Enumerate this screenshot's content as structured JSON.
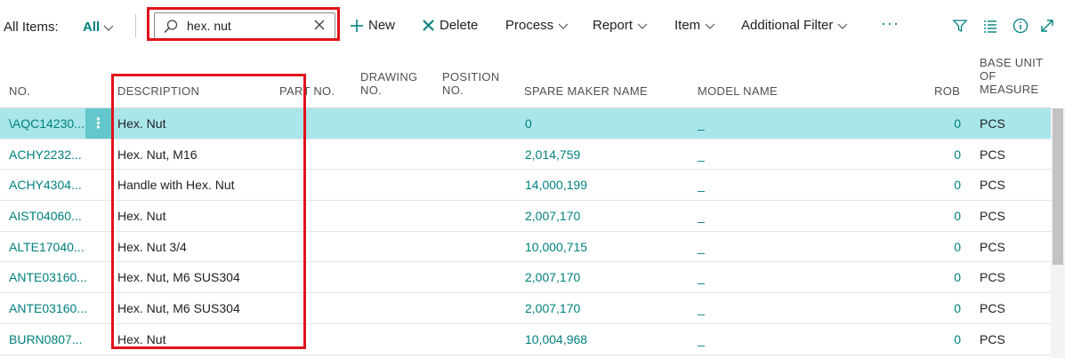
{
  "toolbar": {
    "title": "All Items:",
    "view_label": "All",
    "search_value": "hex. nut",
    "new_label": "New",
    "delete_label": "Delete",
    "process_label": "Process",
    "report_label": "Report",
    "item_label": "Item",
    "additional_filter_label": "Additional Filter",
    "more_label": "···",
    "icons": [
      "search-icon",
      "clear-icon",
      "plus-icon",
      "delete-icon",
      "chevron-down-icon",
      "filter-icon",
      "list-view-icon",
      "info-icon",
      "expand-icon"
    ]
  },
  "table": {
    "headers": {
      "no": "NO.",
      "description": "DESCRIPTION",
      "part_no": "PART NO.",
      "drawing_no_1": "DRAWING",
      "drawing_no_2": "NO.",
      "position_no_1": "POSITION",
      "position_no_2": "NO.",
      "spare_maker_name": "SPARE MAKER NAME",
      "model_name": "MODEL NAME",
      "rob": "ROB",
      "base_unit_1": "BASE UNIT",
      "base_unit_2": "OF",
      "base_unit_3": "MEASURE"
    },
    "rows": [
      {
        "no": "\\AQC14230...",
        "description": "Hex. Nut",
        "spare": "0",
        "model": "_",
        "rob": "0",
        "unit": "PCS"
      },
      {
        "no": "ACHY2232...",
        "description": "Hex. Nut, M16",
        "spare": "2,014,759",
        "model": "_",
        "rob": "0",
        "unit": "PCS"
      },
      {
        "no": "ACHY4304...",
        "description": "Handle with Hex. Nut",
        "spare": "14,000,199",
        "model": "_",
        "rob": "0",
        "unit": "PCS"
      },
      {
        "no": "AIST04060...",
        "description": "Hex. Nut",
        "spare": "2,007,170",
        "model": "_",
        "rob": "0",
        "unit": "PCS"
      },
      {
        "no": "ALTE17040...",
        "description": "Hex. Nut 3/4",
        "spare": "10,000,715",
        "model": "_",
        "rob": "0",
        "unit": "PCS"
      },
      {
        "no": "ANTE03160...",
        "description": "Hex. Nut, M6 SUS304",
        "spare": "2,007,170",
        "model": "_",
        "rob": "0",
        "unit": "PCS"
      },
      {
        "no": "ANTE03160...",
        "description": "Hex. Nut, M6 SUS304",
        "spare": "2,007,170",
        "model": "_",
        "rob": "0",
        "unit": "PCS"
      },
      {
        "no": "BURN0807...",
        "description": "Hex. Nut",
        "spare": "10,004,968",
        "model": "_",
        "rob": "0",
        "unit": "PCS"
      }
    ],
    "row_menu_glyph": "⋮"
  },
  "colors": {
    "accent": "#00807e",
    "selected_row": "#a9e6ea",
    "row_menu": "#63c7cd",
    "highlight_outline": "#e0121a"
  }
}
